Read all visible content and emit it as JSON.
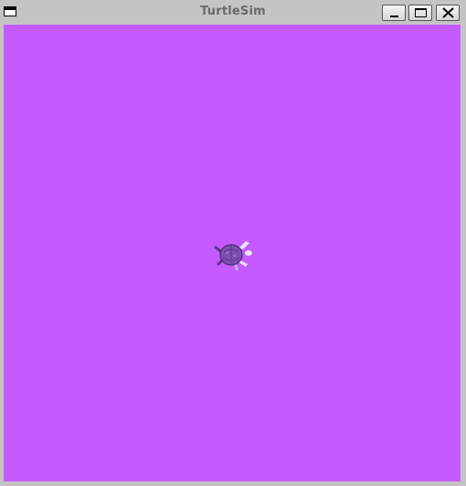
{
  "window": {
    "title": "TurtleSim",
    "icons": {
      "system_menu": "window-menu-icon",
      "minimize": "minimize-icon",
      "maximize": "maximize-icon",
      "close": "close-icon"
    }
  },
  "canvas": {
    "background_color": "#c45aff",
    "turtle": {
      "icon": "turtle-icon",
      "color": "#7d4fb0"
    }
  }
}
